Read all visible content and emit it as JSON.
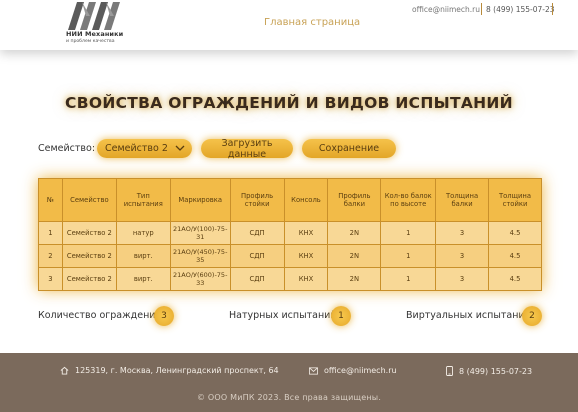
{
  "header": {
    "logo_title": "НИИ Механики",
    "logo_subtitle": "и проблем качества",
    "nav_home": "Главная страница",
    "email": "office@niimech.ru",
    "phone": "8 (499) 155-07-23"
  },
  "page_title": "СВОЙСТВА ОГРАЖДЕНИЙ И ВИДОВ ИСПЫТАНИЙ",
  "controls": {
    "family_label": "Семейство:",
    "family_selected": "Семейство 2",
    "load_button": "Загрузить данные",
    "save_button": "Сохранение"
  },
  "table": {
    "headers": [
      "№",
      "Семейство",
      "Тип испытания",
      "Маркировка",
      "Профиль стойки",
      "Консоль",
      "Профиль балки",
      "Кол-во балок по высоте",
      "Толщина балки",
      "Толщина стойки"
    ],
    "rows": [
      [
        "1",
        "Семейство 2",
        "натур",
        "21АО/У(100)-75-31",
        "СДП",
        "КНХ",
        "2N",
        "1",
        "3",
        "4.5"
      ],
      [
        "2",
        "Семейство 2",
        "вирт.",
        "21АО/У(450)-75-35",
        "СДП",
        "КНХ",
        "2N",
        "1",
        "3",
        "4.5"
      ],
      [
        "3",
        "Семейство 2",
        "вирт.",
        "21АО/У(600)-75-33",
        "СДП",
        "КНХ",
        "2N",
        "1",
        "3",
        "4.5"
      ]
    ]
  },
  "counters": {
    "total_label": "Количество ограждений:",
    "total_value": "3",
    "natural_label": "Натурных испытаний:",
    "natural_value": "1",
    "virtual_label": "Виртуальных испытаний:",
    "virtual_value": "2"
  },
  "footer": {
    "address": "125319, г. Москва, Ленинградский проспект, 64",
    "email": "office@niimech.ru",
    "phone": "8 (499) 155-07-23",
    "copyright": "© ООО МиПК 2023. Все права защищены."
  },
  "colors": {
    "accent": "#f2bb48",
    "button": "#e8ad30",
    "footer_bg": "#7b6a5c",
    "nav_link": "#c8a256"
  },
  "icons": {
    "logo": "logo-mark",
    "select": "chevron-down-icon",
    "address": "home-icon",
    "email": "mail-icon",
    "phone": "phone-icon"
  }
}
